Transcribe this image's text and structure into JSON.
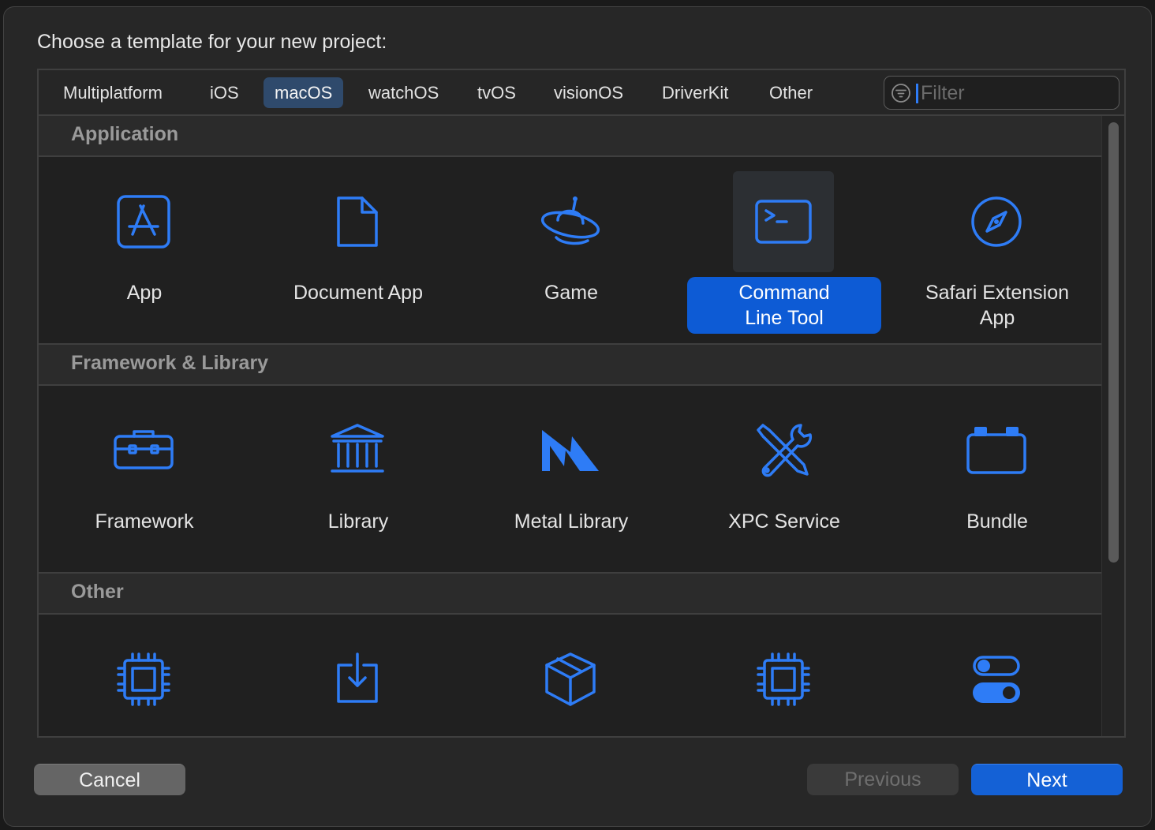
{
  "dialog": {
    "prompt": "Choose a template for your new project:"
  },
  "platform_tabs": [
    {
      "label": "Multiplatform",
      "selected": false
    },
    {
      "label": "iOS",
      "selected": false
    },
    {
      "label": "macOS",
      "selected": true
    },
    {
      "label": "watchOS",
      "selected": false
    },
    {
      "label": "tvOS",
      "selected": false
    },
    {
      "label": "visionOS",
      "selected": false
    },
    {
      "label": "DriverKit",
      "selected": false
    },
    {
      "label": "Other",
      "selected": false
    }
  ],
  "filter": {
    "placeholder": "Filter",
    "value": "",
    "icon": "filter-icon"
  },
  "sections": [
    {
      "title": "Application",
      "items": [
        {
          "label_lines": [
            "App"
          ],
          "icon": "app-store-icon"
        },
        {
          "label_lines": [
            "Document App"
          ],
          "icon": "document-icon"
        },
        {
          "label_lines": [
            "Game"
          ],
          "icon": "ufo-icon"
        },
        {
          "label_lines": [
            "Command",
            "Line Tool"
          ],
          "icon": "terminal-icon",
          "selected": true
        },
        {
          "label_lines": [
            "Safari Extension",
            "App"
          ],
          "icon": "compass-icon"
        }
      ]
    },
    {
      "title": "Framework & Library",
      "items": [
        {
          "label_lines": [
            "Framework"
          ],
          "icon": "toolbox-icon"
        },
        {
          "label_lines": [
            "Library"
          ],
          "icon": "building-columns-icon"
        },
        {
          "label_lines": [
            "Metal Library"
          ],
          "icon": "metal-icon"
        },
        {
          "label_lines": [
            "XPC Service"
          ],
          "icon": "wrench-screwdriver-icon"
        },
        {
          "label_lines": [
            "Bundle"
          ],
          "icon": "bundle-icon"
        }
      ]
    },
    {
      "title": "Other",
      "items": [
        {
          "label_lines": [
            ""
          ],
          "icon": "chip-icon"
        },
        {
          "label_lines": [
            ""
          ],
          "icon": "download-tray-icon"
        },
        {
          "label_lines": [
            ""
          ],
          "icon": "cube-icon"
        },
        {
          "label_lines": [
            ""
          ],
          "icon": "chip-icon"
        },
        {
          "label_lines": [
            ""
          ],
          "icon": "toggles-icon"
        }
      ]
    }
  ],
  "buttons": {
    "cancel": "Cancel",
    "previous": "Previous",
    "next": "Next"
  },
  "colors": {
    "accent": "#2e7cf6",
    "selection": "#0d5bd5",
    "tab_selected": "#2f4a6c",
    "background": "#272727"
  }
}
